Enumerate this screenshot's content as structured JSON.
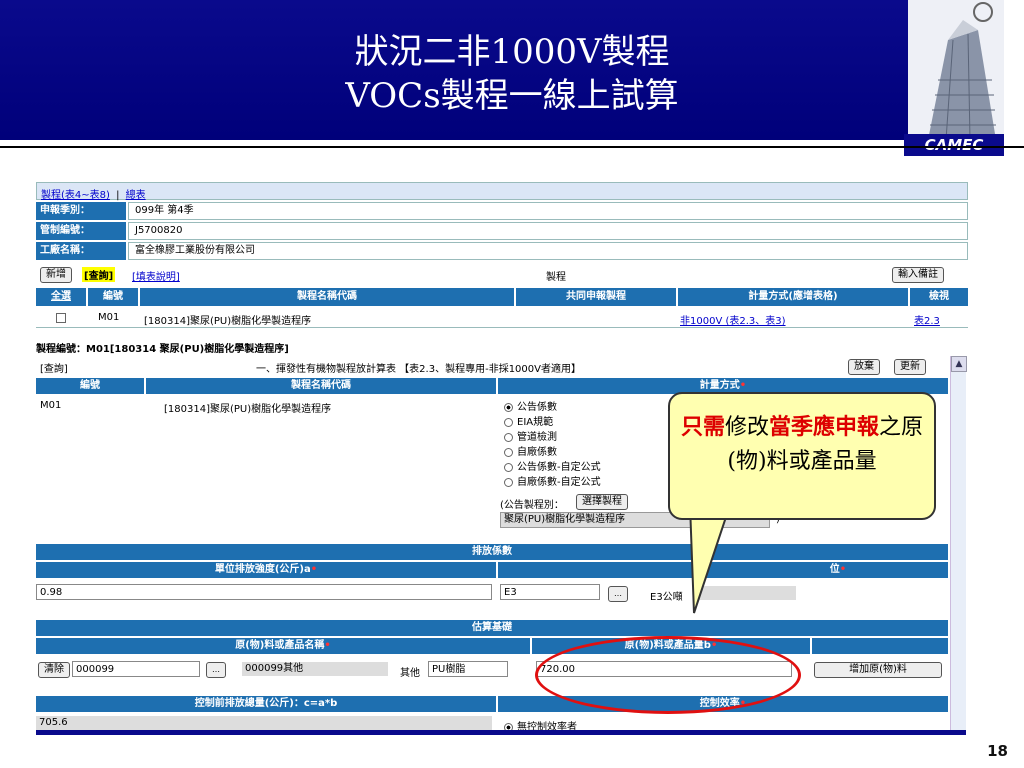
{
  "slide": {
    "title_line1": "狀況二非1000V製程",
    "title_line2": "VOCs製程一線上試算",
    "logo_text": "CAMEC",
    "page_number": "18"
  },
  "tabs": {
    "process": "製程(表4~表8)",
    "separator": "|",
    "summary": "總表"
  },
  "info": [
    {
      "label": "申報季別：",
      "value": "099年 第4季"
    },
    {
      "label": "管制編號：",
      "value": "J5700820"
    },
    {
      "label": "工廠名稱：",
      "value": "富全橡膠工業股份有限公司"
    }
  ],
  "toolbar": {
    "add": "新增",
    "query": "[查詢]",
    "help": "[填表說明]",
    "center": "製程",
    "note": "輸入備註"
  },
  "process_table": {
    "headers": [
      "全選",
      "編號",
      "製程名稱代碼",
      "共同申報製程",
      "計量方式(應增表格)",
      "檢視"
    ],
    "row": {
      "id": "M01",
      "name": "[180314]聚尿(PU)樹脂化學製造程序",
      "shared": "",
      "method": "非1000V (表2.3、表3)",
      "view": "表2.3"
    }
  },
  "section": {
    "heading": "製程編號：M01[180314 聚尿(PU)樹脂化學製造程序]",
    "query": "[查詢]",
    "subtitle": "一、揮發性有機物製程放計算表 【表2.3、製程專用-非採1000V者適用】",
    "discard": "放棄",
    "update": "更新"
  },
  "calc_table": {
    "headers": {
      "id": "編號",
      "name": "製程名稱代碼",
      "method": "計量方式"
    },
    "id": "M01",
    "name": "[180314]聚尿(PU)樹脂化學製造程序",
    "options": [
      "公告係數",
      "EIA規範",
      "管道檢測",
      "自廠係數",
      "公告係數-自定公式",
      "自廠係數-自定公式"
    ],
    "selected_option": 0,
    "category_label": "(公告製程別：",
    "select_button": "選擇製程",
    "category_value": "聚尿(PU)樹脂化學製造程序",
    "category_suffix": ")"
  },
  "emission": {
    "heading": "排放係數",
    "left_header": "單位排放強度(公斤)a",
    "right_header_tail": "位",
    "left_value": "0.98",
    "right_code": "E3",
    "right_unit": "E3公噸"
  },
  "estimation": {
    "heading": "估算基礎",
    "material_header": "原(物)料或產品名稱",
    "amount_header": "原(物)料或產品量b",
    "clear_button": "清除",
    "material_code": "000099",
    "material_name": "000099其他",
    "other_label": "其他",
    "other_value": "PU樹脂",
    "amount_value": "720.00",
    "add_button": "增加原(物)料"
  },
  "bottom": {
    "left_header": "控制前排放總量(公斤)：c=a*b",
    "right_header": "控制效率",
    "left_value": "705.6",
    "right_option": "無控制效率者"
  },
  "callout": {
    "part1": "只需",
    "part2": "修改",
    "part3": "當季應申報",
    "part4": "之原(物)料或產品量"
  },
  "colors": {
    "slide_blue": "#0a0a8c",
    "table_blue": "#1e6fb0",
    "header_light": "#dbe6f6",
    "callout_bg": "#ffffb0",
    "highlight_red": "#e01010"
  }
}
